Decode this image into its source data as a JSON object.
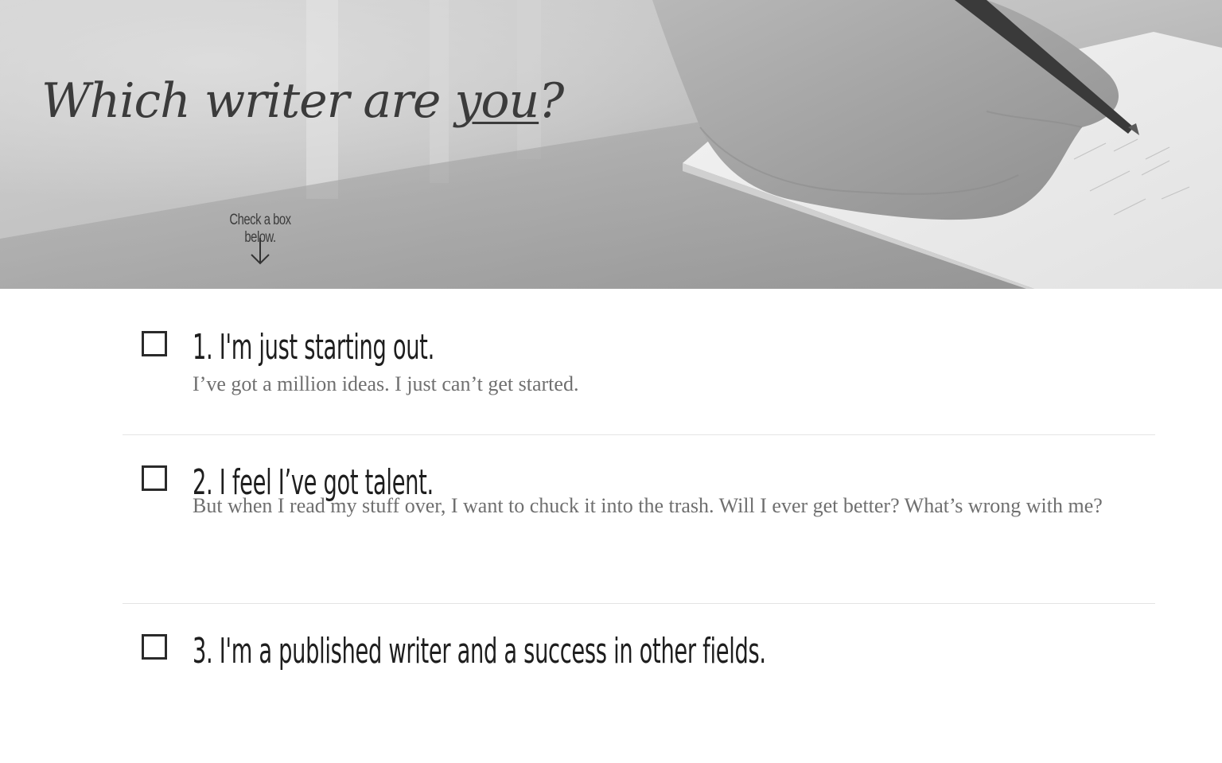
{
  "hero": {
    "title_before": "Which writer are ",
    "title_emphasis": "you",
    "title_after": "?",
    "hint": "Check a box below."
  },
  "options": [
    {
      "title": "1. I'm just starting out.",
      "description": "I’ve got a million ideas. I just can’t get started."
    },
    {
      "title": "2. I feel I’ve got talent.",
      "description": "But when I read my stuff over, I want to chuck it into the trash. Will I ever get better? What’s wrong with me?"
    },
    {
      "title": "3. I'm a published writer and a success in other fields."
    }
  ],
  "colors": {
    "title": "#3b3b3b",
    "heading": "#1e1e1e",
    "body": "#6f6f6f",
    "divider": "#e4e4e4"
  }
}
